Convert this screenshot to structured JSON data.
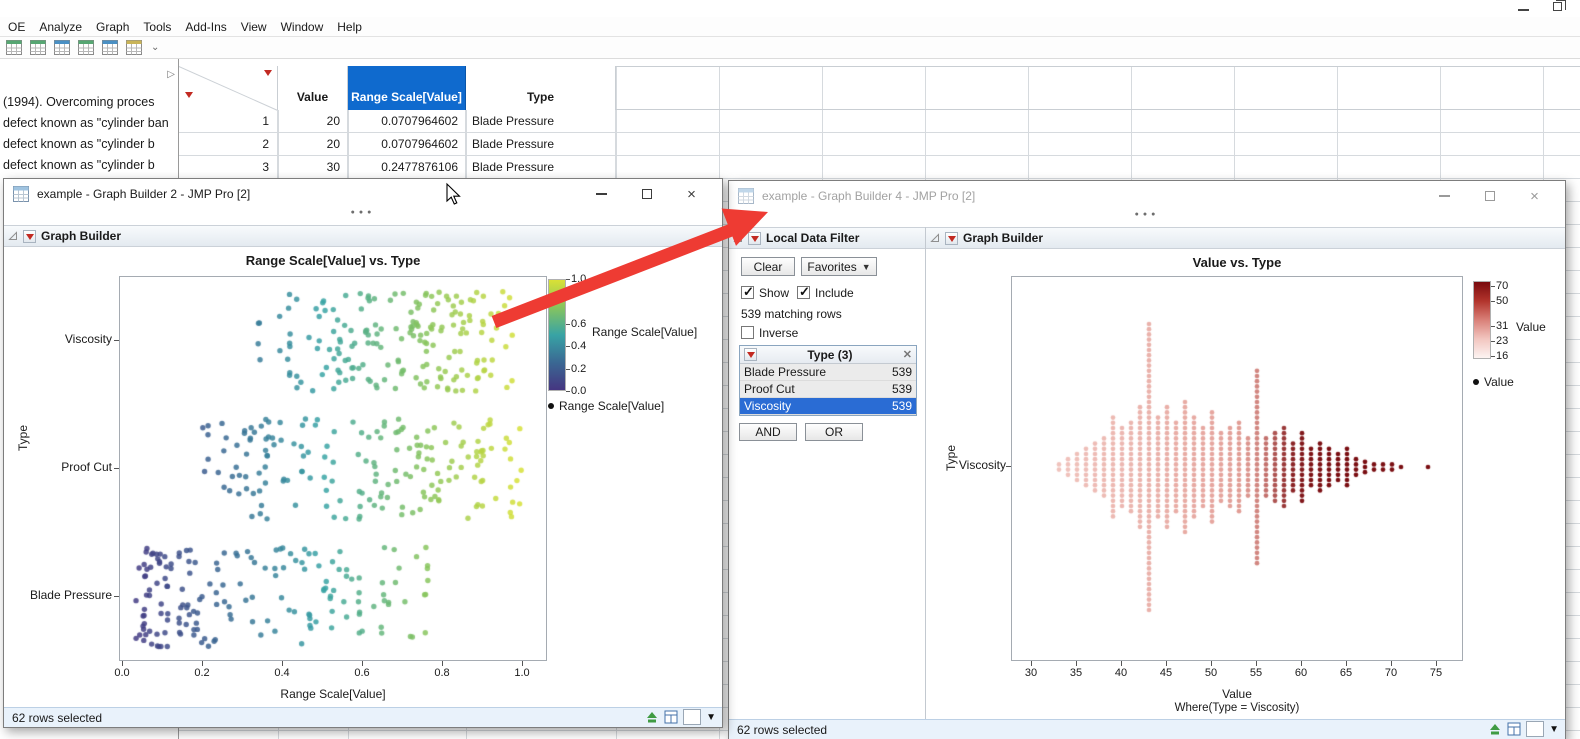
{
  "accent_colors": {
    "selection_blue": "#2a6cd4",
    "header_blue": "#0f6ace",
    "arrow_red": "#ee3b33",
    "status_bg": "#e9f2fb"
  },
  "main_window": {
    "menu_items": [
      "OE",
      "Analyze",
      "Graph",
      "Tools",
      "Add-Ins",
      "View",
      "Window",
      "Help"
    ],
    "toolbar_icons": [
      "new-data-table",
      "open-table",
      "summary-table",
      "formula",
      "script",
      "annotate"
    ],
    "left_pane_lines": [
      "(1994). Overcoming proces",
      "defect known as \"cylinder ban",
      "defect known as \"cylinder b",
      "defect known as \"cylinder b"
    ],
    "table": {
      "columns": [
        "Value",
        "Range Scale[Value]",
        "Type"
      ],
      "selected_column": "Range Scale[Value]",
      "rows": [
        [
          "1",
          "20",
          "0.0707964602",
          "Blade Pressure"
        ],
        [
          "2",
          "20",
          "0.0707964602",
          "Blade Pressure"
        ],
        [
          "3",
          "30",
          "0.2477876106",
          "Blade Pressure"
        ]
      ]
    }
  },
  "window1": {
    "title": "example - Graph Builder 2 - JMP Pro [2]",
    "panel_title": "Graph Builder",
    "status": "62 rows selected"
  },
  "window2": {
    "title": "example - Graph Builder 4 - JMP Pro [2]",
    "panel_title": "Graph Builder",
    "status": "62 rows selected",
    "filter": {
      "title": "Local Data Filter",
      "clear": "Clear",
      "favorites": "Favorites",
      "show": "Show",
      "include": "Include",
      "matching": "539 matching rows",
      "inverse": "Inverse",
      "group_title": "Type (3)",
      "rows": [
        {
          "label": "Blade Pressure",
          "count": "539",
          "selected": false
        },
        {
          "label": "Proof Cut",
          "count": "539",
          "selected": false
        },
        {
          "label": "Viscosity",
          "count": "539",
          "selected": true
        }
      ],
      "and": "AND",
      "or": "OR"
    }
  },
  "chart_data": [
    {
      "type": "scatter",
      "title": "Range Scale[Value] vs. Type",
      "xlabel": "Range Scale[Value]",
      "ylabel": "Type",
      "xlim": [
        0.0,
        1.0
      ],
      "x_ticks": [
        "0.0",
        "0.2",
        "0.4",
        "0.6",
        "0.8",
        "1.0"
      ],
      "categories": [
        "Viscosity",
        "Proof Cut",
        "Blade Pressure"
      ],
      "legend": {
        "gradient_title": "Range Scale[Value]",
        "gradient_ticks": [
          "1.0",
          "0.6",
          "0.4",
          "0.2",
          "0.0"
        ],
        "gradient_colors_top_to_bottom": [
          "#d9e136",
          "#86c45f",
          "#38a3a5",
          "#3a6893",
          "#453581"
        ],
        "point_item": "Range Scale[Value]"
      },
      "series": [
        {
          "name": "Viscosity",
          "points": 185,
          "x_range": [
            0.33,
            0.97
          ],
          "skew": 0.75
        },
        {
          "name": "Proof Cut",
          "points": 180,
          "x_range": [
            0.2,
            1.0
          ],
          "skew": 1.0
        },
        {
          "name": "Blade Pressure",
          "points": 175,
          "x_range": [
            0.04,
            0.76
          ],
          "skew": 1.5
        }
      ]
    },
    {
      "type": "dotplot",
      "title": "Value vs. Type",
      "xlabel": "Value",
      "ylabel": "Type",
      "xlim": [
        28,
        77
      ],
      "x_ticks": [
        "30",
        "35",
        "40",
        "45",
        "50",
        "55",
        "60",
        "65",
        "70",
        "75"
      ],
      "categories": [
        "Viscosity"
      ],
      "legend": {
        "gradient_title": "Value",
        "gradient_ticks": [
          "70",
          "50",
          "31",
          "23",
          "16"
        ],
        "gradient_colors_top_to_bottom": [
          "#7a0b0e",
          "#b2342c",
          "#d98078",
          "#f2c6c0",
          "#fdf4f2"
        ],
        "point_item": "Value"
      },
      "footer": "Where(Type = Viscosity)",
      "columns": [
        {
          "x": 33,
          "count": 2
        },
        {
          "x": 34,
          "count": 4
        },
        {
          "x": 35,
          "count": 6
        },
        {
          "x": 36,
          "count": 8
        },
        {
          "x": 37,
          "count": 10
        },
        {
          "x": 38,
          "count": 12
        },
        {
          "x": 39,
          "count": 20
        },
        {
          "x": 40,
          "count": 16
        },
        {
          "x": 41,
          "count": 18
        },
        {
          "x": 42,
          "count": 24
        },
        {
          "x": 43,
          "count": 56
        },
        {
          "x": 44,
          "count": 20
        },
        {
          "x": 45,
          "count": 24
        },
        {
          "x": 46,
          "count": 18
        },
        {
          "x": 47,
          "count": 26
        },
        {
          "x": 48,
          "count": 20
        },
        {
          "x": 49,
          "count": 16
        },
        {
          "x": 50,
          "count": 22
        },
        {
          "x": 51,
          "count": 14
        },
        {
          "x": 52,
          "count": 16
        },
        {
          "x": 53,
          "count": 18
        },
        {
          "x": 54,
          "count": 12
        },
        {
          "x": 55,
          "count": 38
        },
        {
          "x": 56,
          "count": 12
        },
        {
          "x": 57,
          "count": 14
        },
        {
          "x": 58,
          "count": 16
        },
        {
          "x": 59,
          "count": 10
        },
        {
          "x": 60,
          "count": 14
        },
        {
          "x": 61,
          "count": 8
        },
        {
          "x": 62,
          "count": 10
        },
        {
          "x": 63,
          "count": 8
        },
        {
          "x": 64,
          "count": 6
        },
        {
          "x": 65,
          "count": 8
        },
        {
          "x": 66,
          "count": 4
        },
        {
          "x": 67,
          "count": 3
        },
        {
          "x": 68,
          "count": 2
        },
        {
          "x": 69,
          "count": 2
        },
        {
          "x": 70,
          "count": 2
        },
        {
          "x": 71,
          "count": 1
        },
        {
          "x": 74,
          "count": 1
        }
      ]
    }
  ]
}
